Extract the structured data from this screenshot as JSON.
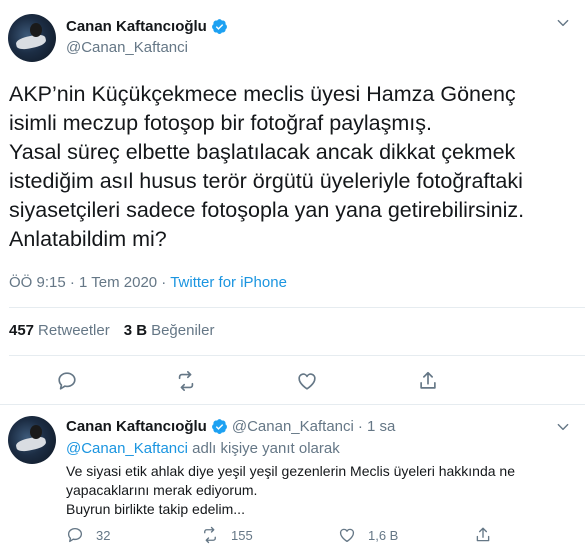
{
  "main_tweet": {
    "author_name": "Canan Kaftancıoğlu",
    "author_handle": "@Canan_Kaftanci",
    "text": "AKP’nin Küçükçekmece meclis üyesi Hamza Gönenç\nisimli meczup fotoşop bir fotoğraf paylaşmış.\nYasal süreç elbette başlatılacak ancak dikkat çekmek\nistediğim asıl husus terör örgütü üyeleriyle fotoğraftaki\nsiyasetçileri sadece fotoşopla yan yana getirebilirsiniz.\nAnlatabildim mi?",
    "timestamp": "ÖÖ 9:15 · 1 Tem 2020 · ",
    "source": "Twitter for iPhone",
    "retweets_count": "457",
    "retweets_label": "Retweetler",
    "likes_count": "3 B",
    "likes_label": "Beğeniler"
  },
  "reply_tweet": {
    "author_name": "Canan Kaftancıoğlu",
    "author_handle": "@Canan_Kaftanci",
    "time": "· 1 sa",
    "replying_handle": "@Canan_Kaftanci",
    "replying_suffix": " adlı kişiye yanıt olarak",
    "text": "Ve siyasi etik ahlak diye yeşil yeşil gezenlerin Meclis üyeleri hakkında ne\nyapacaklarını merak ediyorum.\nBuyrun birlikte takip edelim...",
    "reply_count": "32",
    "retweet_count": "155",
    "like_count": "1,6 B"
  },
  "icons": {
    "verified": "verified-badge-icon",
    "caret": "chevron-down-icon",
    "reply": "reply-icon",
    "retweet": "retweet-icon",
    "like": "heart-icon",
    "share": "share-icon"
  },
  "colors": {
    "accent": "#1b95e0",
    "verified": "#1da1f2",
    "secondary_text": "#657786",
    "divider": "#e6ecf0"
  }
}
